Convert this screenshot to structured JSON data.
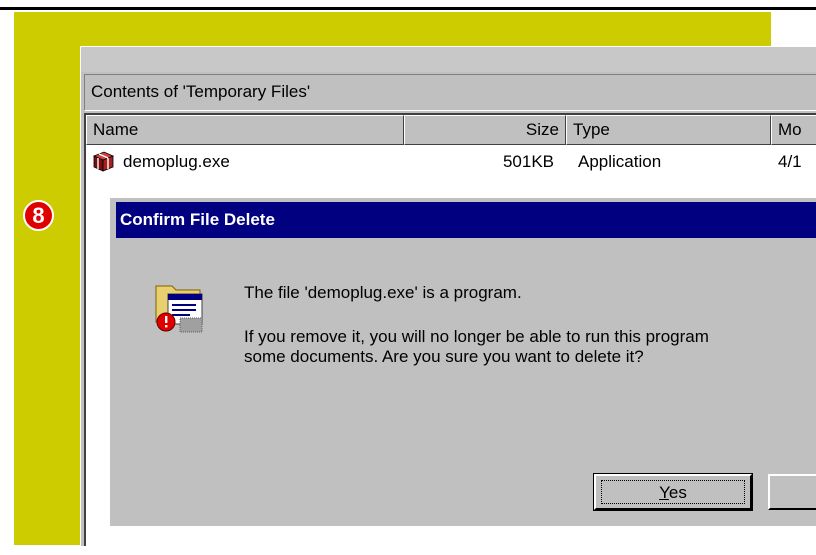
{
  "step_badge": "8",
  "explorer": {
    "contents_title": "Contents of 'Temporary Files'",
    "columns": {
      "name": "Name",
      "size": "Size",
      "type": "Type",
      "modified": "Mo"
    },
    "file": {
      "name": "demoplug.exe",
      "size": "501KB",
      "type": "Application",
      "modified": "4/1"
    }
  },
  "dialog": {
    "title": "Confirm File Delete",
    "message1": "The file 'demoplug.exe' is a program.",
    "message2_line1": "If you remove it, you will no longer be able to run this program",
    "message2_line2": "some documents. Are you sure you want to delete it?",
    "yes_prefix": "",
    "yes_underlined": "Y",
    "yes_rest": "es",
    "no_label": ""
  },
  "colors": {
    "panel": "#cccc00",
    "title_bar": "#000080",
    "face": "#c0c0c0",
    "badge": "#e00000"
  }
}
